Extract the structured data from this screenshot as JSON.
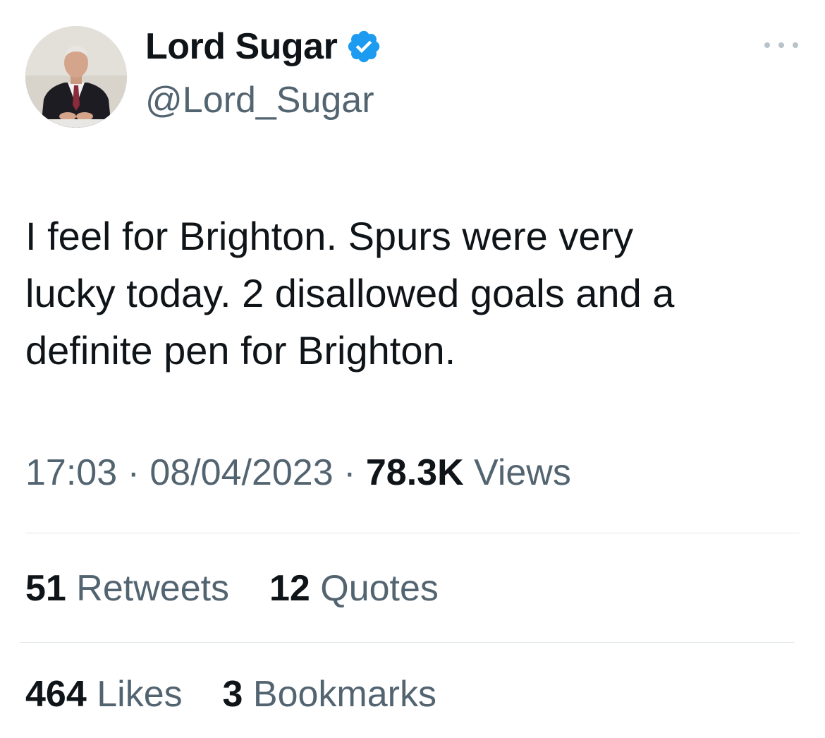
{
  "author": {
    "display_name": "Lord Sugar",
    "handle": "@Lord_Sugar",
    "verified_icon": "verified-badge-icon",
    "verified_color": "#1d9bf0"
  },
  "tweet": {
    "text": "I feel for Brighton. Spurs were very\nlucky today. 2 disallowed goals and a\ndefinite pen for Brighton.",
    "time": "17:03",
    "separator": "·",
    "date": "08/04/2023",
    "views_count": "78.3K",
    "views_label": "Views"
  },
  "stats": {
    "retweets_count": "51",
    "retweets_label": "Retweets",
    "quotes_count": "12",
    "quotes_label": "Quotes",
    "likes_count": "464",
    "likes_label": "Likes",
    "bookmarks_count": "3",
    "bookmarks_label": "Bookmarks"
  },
  "colors": {
    "text_primary": "#0f1419",
    "text_secondary": "#536471",
    "divider": "#e1e6ea",
    "accent": "#1d9bf0"
  }
}
